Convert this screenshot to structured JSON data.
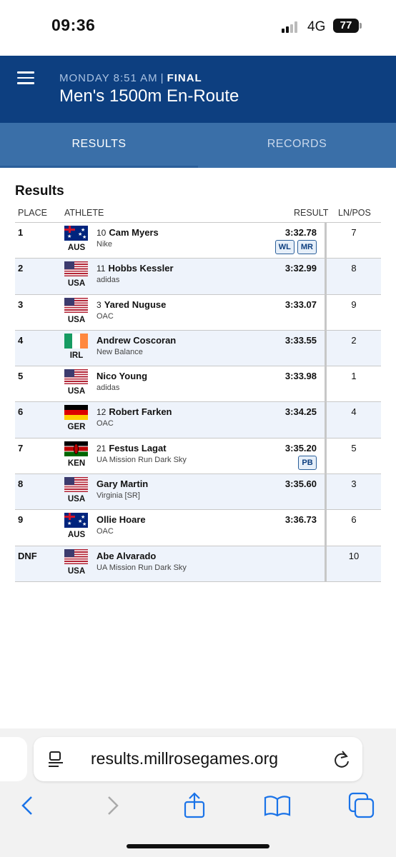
{
  "status_bar": {
    "time": "09:36",
    "network": "4G",
    "battery": "77"
  },
  "header": {
    "day_time": "MONDAY 8:51 AM",
    "separator": "|",
    "status": "FINAL",
    "title": "Men's 1500m En-Route",
    "menu_icon": "hamburger-menu-icon"
  },
  "tabs": [
    {
      "label": "RESULTS",
      "active": true
    },
    {
      "label": "RECORDS",
      "active": false
    }
  ],
  "results": {
    "section_title": "Results",
    "columns": {
      "place": "PLACE",
      "athlete": "ATHLETE",
      "result": "RESULT",
      "lnpos": "LN/POS"
    },
    "rows": [
      {
        "place": "1",
        "country": "AUS",
        "bib": "10",
        "name": "Cam Myers",
        "team": "Nike",
        "result": "3:32.78",
        "badges": [
          "WL",
          "MR"
        ],
        "lnpos": "7"
      },
      {
        "place": "2",
        "country": "USA",
        "bib": "11",
        "name": "Hobbs Kessler",
        "team": "adidas",
        "result": "3:32.99",
        "badges": [],
        "lnpos": "8"
      },
      {
        "place": "3",
        "country": "USA",
        "bib": "3",
        "name": "Yared Nuguse",
        "team": "OAC",
        "result": "3:33.07",
        "badges": [],
        "lnpos": "9"
      },
      {
        "place": "4",
        "country": "IRL",
        "bib": "",
        "name": "Andrew Coscoran",
        "team": "New Balance",
        "result": "3:33.55",
        "badges": [],
        "lnpos": "2"
      },
      {
        "place": "5",
        "country": "USA",
        "bib": "",
        "name": "Nico Young",
        "team": "adidas",
        "result": "3:33.98",
        "badges": [],
        "lnpos": "1"
      },
      {
        "place": "6",
        "country": "GER",
        "bib": "12",
        "name": "Robert Farken",
        "team": "OAC",
        "result": "3:34.25",
        "badges": [],
        "lnpos": "4"
      },
      {
        "place": "7",
        "country": "KEN",
        "bib": "21",
        "name": "Festus Lagat",
        "team": "UA Mission Run Dark Sky",
        "result": "3:35.20",
        "badges": [
          "PB"
        ],
        "lnpos": "5"
      },
      {
        "place": "8",
        "country": "USA",
        "bib": "",
        "name": "Gary Martin",
        "team": "Virginia [SR]",
        "result": "3:35.60",
        "badges": [],
        "lnpos": "3"
      },
      {
        "place": "9",
        "country": "AUS",
        "bib": "",
        "name": "Ollie Hoare",
        "team": "OAC",
        "result": "3:36.73",
        "badges": [],
        "lnpos": "6"
      },
      {
        "place": "DNF",
        "country": "USA",
        "bib": "",
        "name": "Abe Alvarado",
        "team": "UA Mission Run Dark Sky",
        "result": "",
        "badges": [],
        "lnpos": "10"
      }
    ]
  },
  "browser": {
    "url": "results.millrosegames.org",
    "icons": [
      "page-menu-icon",
      "reload-icon",
      "back-icon",
      "forward-icon",
      "share-icon",
      "bookmarks-icon",
      "tabs-icon"
    ]
  },
  "colors": {
    "header_bg": "#0d3f80",
    "tabs_bg": "#3a6fa8",
    "row_alt": "#eef3fb",
    "badge_border": "#2b5f9a"
  }
}
